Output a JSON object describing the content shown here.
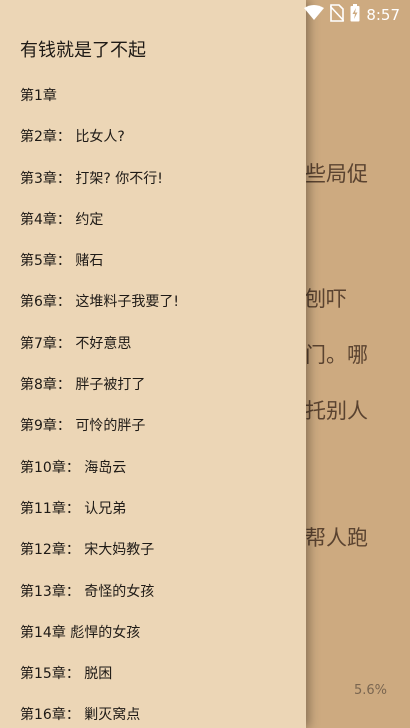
{
  "status_bar": {
    "time": "8:57",
    "icons": [
      "wifi-icon",
      "no-sim-icon",
      "battery-charging-icon"
    ]
  },
  "reader": {
    "visible_text_fragments": [
      "些局促",
      "刨吓",
      "门。哪",
      "托别人",
      "帮人跑"
    ],
    "progress": "5.6%"
  },
  "drawer": {
    "book_title": "有钱就是了不起",
    "chapters": [
      "第1章",
      "第2章： 比女人?",
      "第3章： 打架? 你不行!",
      "第4章： 约定",
      "第5章： 赌石",
      "第6章： 这堆料子我要了!",
      "第7章： 不好意思",
      "第8章： 胖子被打了",
      "第9章： 可怜的胖子",
      "第10章： 海岛云",
      "第11章： 认兄弟",
      "第12章： 宋大妈教子",
      "第13章： 奇怪的女孩",
      "第14章  彪悍的女孩",
      "第15章： 脱困",
      "第16章： 剿灭窝点"
    ]
  },
  "colors": {
    "drawer_bg": "#ecd6b6",
    "reader_bg": "#cdaa80",
    "text": "#1e1a16"
  }
}
